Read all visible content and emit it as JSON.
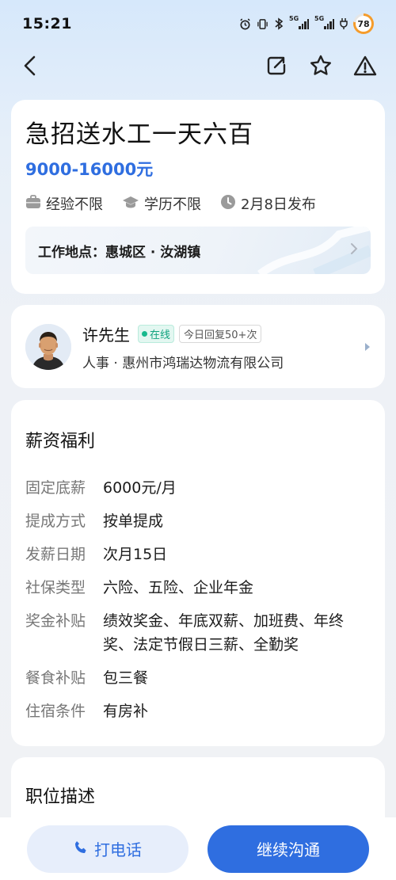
{
  "status_bar": {
    "time": "15:21",
    "network_1": "5G",
    "network_2": "5G",
    "battery": "78",
    "icons": [
      "alarm-icon",
      "vibrate-icon",
      "bluetooth-icon",
      "signal-icon",
      "signal-icon",
      "charging-icon"
    ]
  },
  "nav": {
    "icons": [
      "back-icon",
      "share-icon",
      "star-icon",
      "warning-icon"
    ]
  },
  "job": {
    "title": "急招送水工一天六百",
    "salary": "9000-16000元",
    "tags": [
      {
        "icon": "briefcase-icon",
        "label": "经验不限"
      },
      {
        "icon": "graduation-cap-icon",
        "label": "学历不限"
      },
      {
        "icon": "clock-icon",
        "label": "2月8日发布"
      }
    ],
    "location": "工作地点：惠城区 · 汝湖镇"
  },
  "recruiter": {
    "name": "许先生",
    "online_badge": "在线",
    "reply_badge": "今日回复50+次",
    "company_line": "人事 · 惠州市鸿瑞达物流有限公司"
  },
  "benefits": {
    "section_title": "薪资福利",
    "rows": [
      {
        "label": "固定底薪",
        "value": "6000元/月"
      },
      {
        "label": "提成方式",
        "value": "按单提成"
      },
      {
        "label": "发薪日期",
        "value": "次月15日"
      },
      {
        "label": "社保类型",
        "value": "六险、五险、企业年金"
      },
      {
        "label": "奖金补贴",
        "value": "绩效奖金、年底双薪、加班费、年终奖、法定节假日三薪、全勤奖"
      },
      {
        "label": "餐食补贴",
        "value": "包三餐"
      },
      {
        "label": "住宿条件",
        "value": "有房补"
      }
    ]
  },
  "description": {
    "section_title": "职位描述"
  },
  "actions": {
    "call_label": "打电话",
    "chat_label": "继续沟通"
  },
  "colors": {
    "accent": "#2f6ee0",
    "online": "#16b98d",
    "battery": "#f59c2b"
  }
}
